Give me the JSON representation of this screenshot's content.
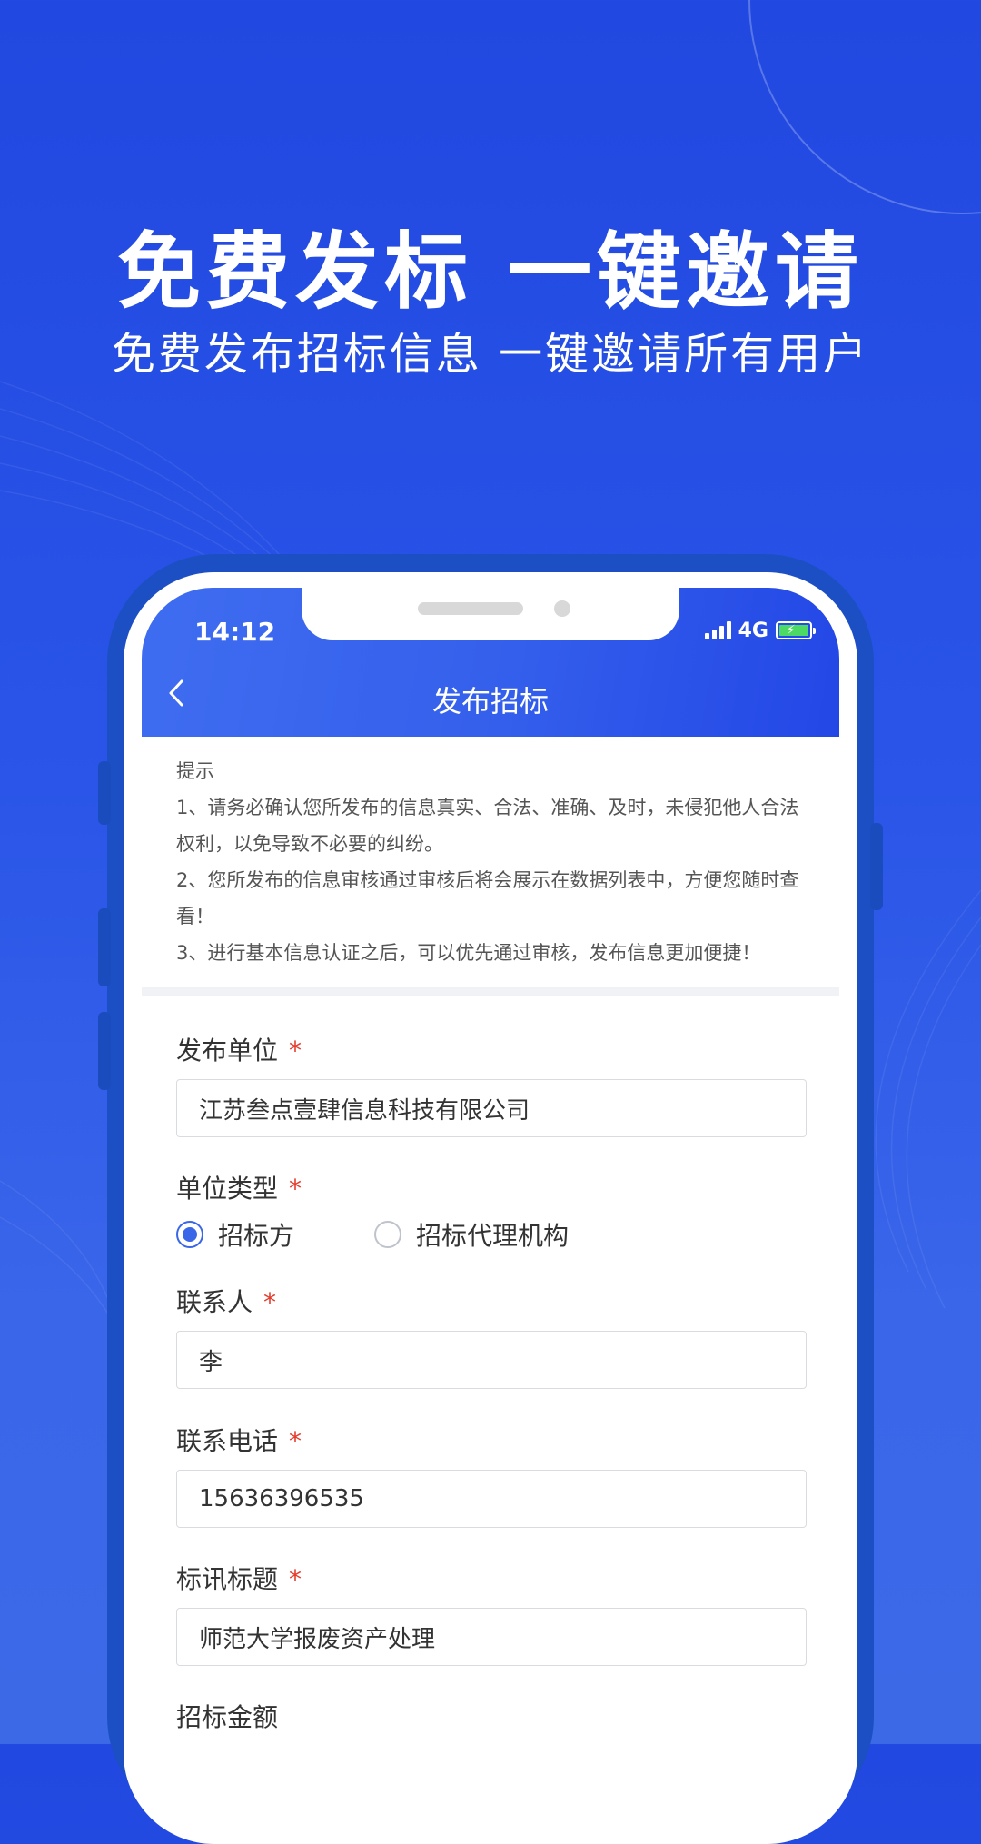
{
  "promo": {
    "headline": "免费发标  一键邀请",
    "subline": "免费发布招标信息 一键邀请所有用户"
  },
  "status_bar": {
    "time": "14:12",
    "network": "4G"
  },
  "appbar": {
    "title": "发布招标"
  },
  "tips": {
    "heading": "提示",
    "items": [
      "1、请务必确认您所发布的信息真实、合法、准确、及时，未侵犯他人合法权利，以免导致不必要的纠纷。",
      "2、您所发布的信息审核通过审核后将会展示在数据列表中，方便您随时查看！",
      "3、进行基本信息认证之后，可以优先通过审核，发布信息更加便捷！"
    ]
  },
  "form": {
    "required_mark": "*",
    "publisher": {
      "label": "发布单位",
      "value": "江苏叁点壹肆信息科技有限公司"
    },
    "unit_type": {
      "label": "单位类型",
      "options": [
        "招标方",
        "招标代理机构"
      ],
      "selected": "招标方"
    },
    "contact": {
      "label": "联系人",
      "value": "李"
    },
    "phone": {
      "label": "联系电话",
      "value": "15636396535"
    },
    "bid_title": {
      "label": "标讯标题",
      "value": "师范大学报废资产处理"
    },
    "amount": {
      "label": "招标金额"
    }
  },
  "colors": {
    "brand_blue": "#2148e0",
    "accent": "#3a66e8",
    "required": "#e53b2c"
  }
}
